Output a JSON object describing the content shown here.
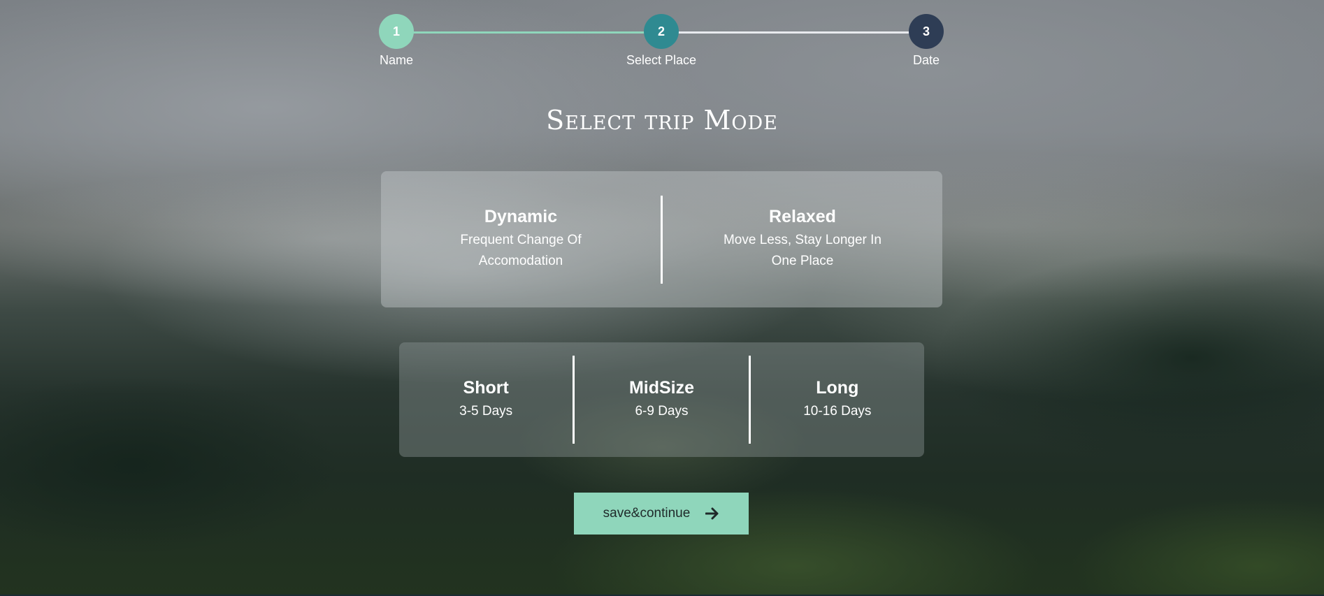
{
  "stepper": {
    "steps": [
      {
        "number": "1",
        "label": "Name",
        "color": "#8fd6bb",
        "status": "completed"
      },
      {
        "number": "2",
        "label": "Select Place",
        "color": "#2f8a91",
        "status": "current"
      },
      {
        "number": "3",
        "label": "Date",
        "color": "#2e3d55",
        "status": "upcoming"
      }
    ]
  },
  "title": "Select trip Mode",
  "mode_options": [
    {
      "title": "Dynamic",
      "description": "Frequent Change Of Accomodation"
    },
    {
      "title": "Relaxed",
      "description": "Move Less, Stay Longer In One Place"
    }
  ],
  "duration_options": [
    {
      "title": "Short",
      "range": "3-5 Days"
    },
    {
      "title": "MidSize",
      "range": "6-9 Days"
    },
    {
      "title": "Long",
      "range": "10-16 Days"
    }
  ],
  "save_button": {
    "label": "save&continue",
    "icon": "arrow-right-icon",
    "color": "#8fd6bb"
  },
  "colors": {
    "accent": "#8fd6bb",
    "text": "#ffffff"
  }
}
